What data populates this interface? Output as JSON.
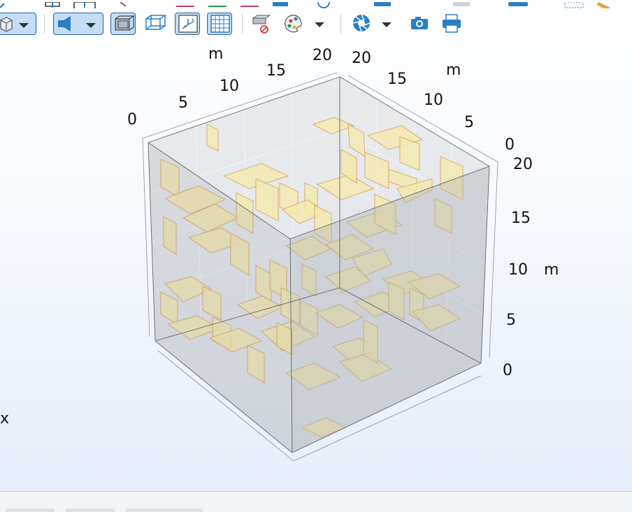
{
  "toolbar": {
    "buttons": [
      {
        "name": "view-cube-icon",
        "active": true,
        "dropdown": true
      },
      {
        "name": "scene-light-icon",
        "active": true,
        "dropdown": true
      },
      {
        "name": "transparency-icon",
        "active": true
      },
      {
        "name": "wireframe-icon",
        "active": false
      },
      {
        "name": "show-axes-icon",
        "active": true
      },
      {
        "name": "show-grid-icon",
        "active": true
      },
      {
        "name": "clear-selection-icon",
        "active": false
      },
      {
        "name": "color-palette-icon",
        "active": false,
        "dropdown": true
      },
      {
        "name": "aperture-icon",
        "active": false,
        "dropdown": true
      },
      {
        "name": "screenshot-camera-icon",
        "active": false
      },
      {
        "name": "print-icon",
        "active": false
      }
    ]
  },
  "axes": {
    "left_axis": {
      "unit": "m",
      "ticks": [
        "0",
        "5",
        "10",
        "15",
        "20"
      ]
    },
    "right_axis": {
      "unit": "m",
      "ticks": [
        "20",
        "15",
        "10",
        "5",
        "0"
      ]
    },
    "vertical_axis": {
      "unit": "m",
      "ticks": [
        "20",
        "15",
        "10",
        "5",
        "0"
      ]
    }
  },
  "triad": {
    "x_label": "x"
  },
  "colors": {
    "box_fill": "#b9bcc1",
    "fracture_fill": "#f3e79f",
    "fracture_stroke": "#d09a4f",
    "active_button": "#c4dcf6",
    "icon_blue": "#2a7fc4"
  }
}
